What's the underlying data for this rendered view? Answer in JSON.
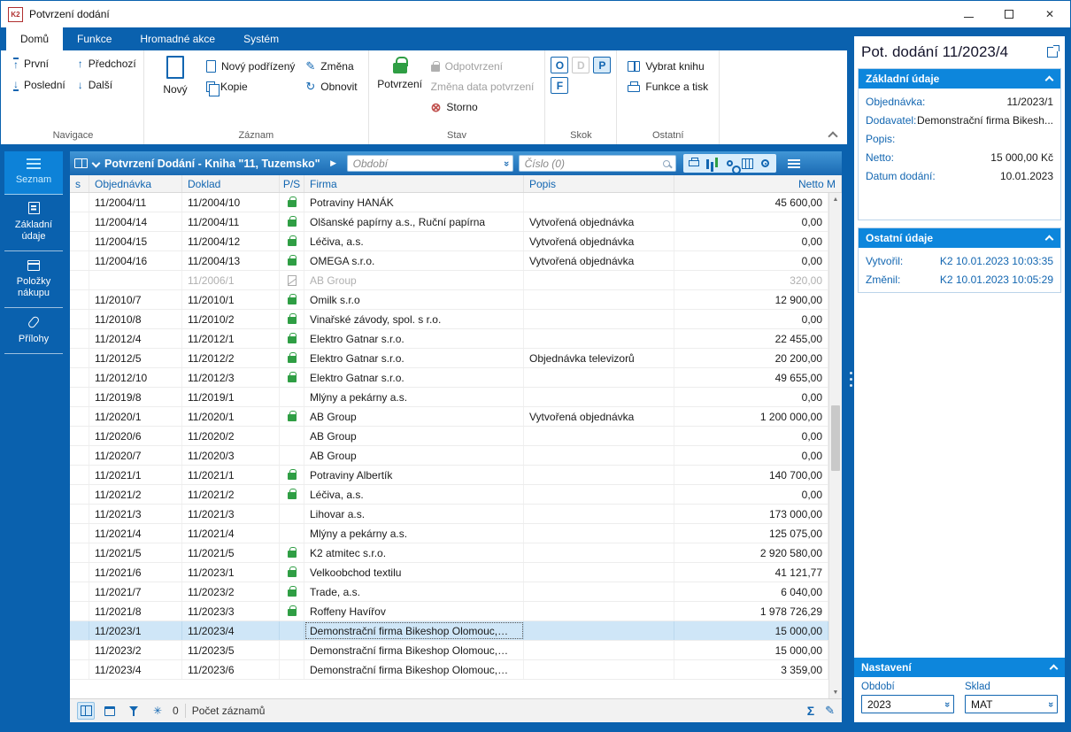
{
  "window": {
    "title": "Potvrzení dodání"
  },
  "icons": {
    "up": "↑",
    "down": "↓",
    "pencil": "✎",
    "refresh": "↻",
    "storno": "⊗",
    "play": "▶",
    "dropdown": "»",
    "sum": "Σ",
    "edit": "✎",
    "asterisk": "✳",
    "close": "✕",
    "scroll_up": "▲",
    "scroll_down": "▼"
  },
  "ribbon": {
    "tabs": [
      "Domů",
      "Funkce",
      "Hromadné akce",
      "Systém"
    ],
    "navigace": {
      "label": "Navigace",
      "prvni": "První",
      "predchozi": "Předchozí",
      "posledni": "Poslední",
      "dalsi": "Další"
    },
    "zaznam": {
      "label": "Záznam",
      "novy": "Nový",
      "novy_podrizeny": "Nový podřízený",
      "kopie": "Kopie",
      "zmena": "Změna",
      "obnovit": "Obnovit"
    },
    "stav": {
      "label": "Stav",
      "potvrzeni": "Potvrzení",
      "odpotvrzeni": "Odpotvrzení",
      "zmena_data": "Změna data potvrzení",
      "storno": "Storno"
    },
    "skok": {
      "label": "Skok",
      "o": "O",
      "d": "D",
      "p": "P",
      "f": "F"
    },
    "ostatni": {
      "label": "Ostatní",
      "vybrat_knihu": "Vybrat knihu",
      "funkce_a_tisk": "Funkce a tisk"
    }
  },
  "sidebar": {
    "items": [
      "Seznam",
      "Základní údaje",
      "Položky nákupu",
      "Přílohy"
    ]
  },
  "caption": {
    "title": "Potvrzení Dodání - Kniha \"11, Tuzemsko\"",
    "obdobi_placeholder": "Období",
    "cislo_placeholder": "Číslo (0)"
  },
  "grid": {
    "columns": [
      "s",
      "Objednávka",
      "Doklad",
      "P/S",
      "Firma",
      "Popis",
      "Netto M"
    ],
    "rows": [
      {
        "objednavka": "11/2004/11",
        "doklad": "11/2004/10",
        "lock": "green",
        "firma": "Potraviny HANÁK",
        "popis": "",
        "netto": "45 600,00"
      },
      {
        "objednavka": "11/2004/14",
        "doklad": "11/2004/11",
        "lock": "green",
        "firma": "Olšanské papírny a.s., Ruční papírna",
        "popis": "Vytvořená objednávka",
        "netto": "0,00"
      },
      {
        "objednavka": "11/2004/15",
        "doklad": "11/2004/12",
        "lock": "green",
        "firma": "Léčiva, a.s.",
        "popis": "Vytvořená objednávka",
        "netto": "0,00"
      },
      {
        "objednavka": "11/2004/16",
        "doklad": "11/2004/13",
        "lock": "green",
        "firma": "OMEGA s.r.o.",
        "popis": "Vytvořená objednávka",
        "netto": "0,00"
      },
      {
        "objednavka": "",
        "doklad": "11/2006/1",
        "lock": "doc",
        "firma": "AB Group",
        "popis": "",
        "netto": "320,00",
        "muted": true
      },
      {
        "objednavka": "11/2010/7",
        "doklad": "11/2010/1",
        "lock": "green",
        "firma": "Omilk s.r.o",
        "popis": "",
        "netto": "12 900,00"
      },
      {
        "objednavka": "11/2010/8",
        "doklad": "11/2010/2",
        "lock": "green",
        "firma": "Vinařské závody, spol. s r.o.",
        "popis": "",
        "netto": "0,00"
      },
      {
        "objednavka": "11/2012/4",
        "doklad": "11/2012/1",
        "lock": "green",
        "firma": "Elektro Gatnar s.r.o.",
        "popis": "",
        "netto": "22 455,00"
      },
      {
        "objednavka": "11/2012/5",
        "doklad": "11/2012/2",
        "lock": "green",
        "firma": "Elektro Gatnar s.r.o.",
        "popis": "Objednávka televizorů",
        "netto": "20 200,00"
      },
      {
        "objednavka": "11/2012/10",
        "doklad": "11/2012/3",
        "lock": "green",
        "firma": "Elektro Gatnar s.r.o.",
        "popis": "",
        "netto": "49 655,00"
      },
      {
        "objednavka": "11/2019/8",
        "doklad": "11/2019/1",
        "lock": "",
        "firma": "Mlýny a pekárny a.s.",
        "popis": "",
        "netto": "0,00"
      },
      {
        "objednavka": "11/2020/1",
        "doklad": "11/2020/1",
        "lock": "green",
        "firma": "AB Group",
        "popis": "Vytvořená objednávka",
        "netto": "1 200 000,00"
      },
      {
        "objednavka": "11/2020/6",
        "doklad": "11/2020/2",
        "lock": "",
        "firma": "AB Group",
        "popis": "",
        "netto": "0,00"
      },
      {
        "objednavka": "11/2020/7",
        "doklad": "11/2020/3",
        "lock": "",
        "firma": "AB Group",
        "popis": "",
        "netto": "0,00"
      },
      {
        "objednavka": "11/2021/1",
        "doklad": "11/2021/1",
        "lock": "green",
        "firma": "Potraviny Albertík",
        "popis": "",
        "netto": "140 700,00"
      },
      {
        "objednavka": "11/2021/2",
        "doklad": "11/2021/2",
        "lock": "green",
        "firma": "Léčiva, a.s.",
        "popis": "",
        "netto": "0,00"
      },
      {
        "objednavka": "11/2021/3",
        "doklad": "11/2021/3",
        "lock": "",
        "firma": "Lihovar a.s.",
        "popis": "",
        "netto": "173 000,00"
      },
      {
        "objednavka": "11/2021/4",
        "doklad": "11/2021/4",
        "lock": "",
        "firma": "Mlýny a pekárny a.s.",
        "popis": "",
        "netto": "125 075,00"
      },
      {
        "objednavka": "11/2021/5",
        "doklad": "11/2021/5",
        "lock": "green",
        "firma": "K2 atmitec s.r.o.",
        "popis": "",
        "netto": "2 920 580,00"
      },
      {
        "objednavka": "11/2021/6",
        "doklad": "11/2023/1",
        "lock": "green",
        "firma": "Velkoobchod textilu",
        "popis": "",
        "netto": "41 121,77"
      },
      {
        "objednavka": "11/2021/7",
        "doklad": "11/2023/2",
        "lock": "green",
        "firma": "Trade, a.s.",
        "popis": "",
        "netto": "6 040,00"
      },
      {
        "objednavka": "11/2021/8",
        "doklad": "11/2023/3",
        "lock": "green",
        "firma": "Roffeny Havířov",
        "popis": "",
        "netto": "1 978 726,29"
      },
      {
        "objednavka": "11/2023/1",
        "doklad": "11/2023/4",
        "lock": "",
        "firma": "Demonstrační firma Bikeshop Olomouc,…",
        "popis": "",
        "netto": "15 000,00",
        "selected": true
      },
      {
        "objednavka": "11/2023/2",
        "doklad": "11/2023/5",
        "lock": "",
        "firma": "Demonstrační firma Bikeshop Olomouc,…",
        "popis": "",
        "netto": "15 000,00"
      },
      {
        "objednavka": "11/2023/4",
        "doklad": "11/2023/6",
        "lock": "",
        "firma": "Demonstrační firma Bikeshop Olomouc,…",
        "popis": "",
        "netto": "3 359,00"
      }
    ]
  },
  "statusbar": {
    "count": "0",
    "records_label": "Počet záznamů"
  },
  "detail": {
    "title": "Pot. dodání 11/2023/4",
    "zakladni": {
      "header": "Základní údaje",
      "fields": [
        {
          "label": "Objednávka:",
          "value": "11/2023/1"
        },
        {
          "label": "Dodavatel:",
          "value": "Demonstrační firma Bikesh..."
        },
        {
          "label": "Popis:",
          "value": ""
        },
        {
          "label": "Netto:",
          "value": "15 000,00 Kč"
        },
        {
          "label": "Datum dodání:",
          "value": "10.01.2023"
        }
      ]
    },
    "ostatni": {
      "header": "Ostatní údaje",
      "fields": [
        {
          "label": "Vytvořil:",
          "value": "K2 10.01.2023 10:03:35"
        },
        {
          "label": "Změnil:",
          "value": "K2 10.01.2023 10:05:29"
        }
      ]
    },
    "nastaveni": {
      "header": "Nastavení",
      "obdobi_label": "Období",
      "obdobi_value": "2023",
      "sklad_label": "Sklad",
      "sklad_value": "MAT"
    }
  }
}
